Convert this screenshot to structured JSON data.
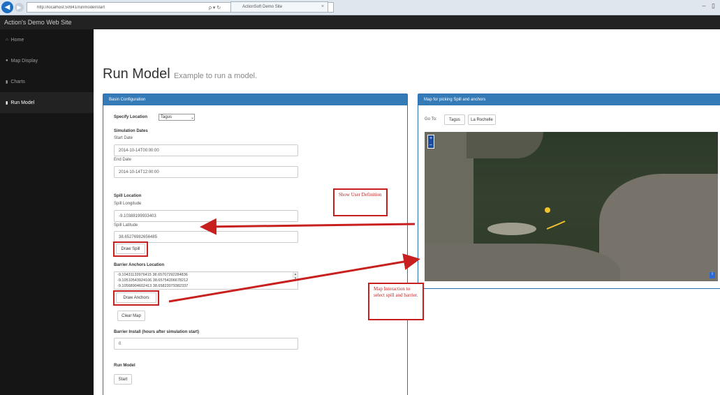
{
  "browser": {
    "url": "http://localhost:50941/runmodel/start",
    "address_controls": "ρ ▾ ↻",
    "tab_title": "ActionSoft Demo Site",
    "window_controls": "– ▯"
  },
  "navbar": {
    "brand": "Action's Demo Web Site"
  },
  "sidebar": {
    "items": [
      {
        "icon": "home-icon",
        "glyph": "⌂",
        "label": "Home"
      },
      {
        "icon": "map-marker-icon",
        "glyph": "●",
        "label": "Map Display"
      },
      {
        "icon": "bar-chart-icon",
        "glyph": "▮",
        "label": "Charts"
      },
      {
        "icon": "bar-chart-icon",
        "glyph": "▮",
        "label": "Run Model"
      }
    ],
    "active_index": 3
  },
  "page": {
    "title": "Run Model",
    "subtitle": "Example to run a model."
  },
  "basin": {
    "title": "Basin Configuration",
    "specify_location_label": "Specify Location",
    "specify_location_value": "Tagus",
    "simulation_dates_label": "Simulation Dates",
    "start_date_label": "Start Date",
    "start_date_value": "2014-10-14T00:00:00",
    "end_date_label": "End Date",
    "end_date_value": "2014-10-14T12:00:00",
    "spill_location_label": "Spill Location",
    "spill_longitude_label": "Spill Longitude",
    "spill_longitude_value": "-9.10388199933403",
    "spill_latitude_label": "Spill Latitude",
    "spill_latitude_value": "38.65276982656485",
    "draw_spill_label": "Draw Spill",
    "barrier_anchors_label": "Barrier Anchors Location",
    "anchors": [
      "-9.10431133976415 38.65707292284836",
      "-9.10510543924106 38.65754206678212",
      "-9.10568904602413 38.65823079382337"
    ],
    "draw_anchors_label": "Draw Anchors",
    "clear_map_label": "Clear Map",
    "barrier_install_label": "Barrier Install (hours after simulation start)",
    "barrier_install_value": "0",
    "run_model_label": "Run Model",
    "start_label": "Start"
  },
  "map_panel": {
    "title": "Map for picking Spill and anchors",
    "goto_label": "Go To:",
    "locations": [
      "Tagus",
      "La Rochelle"
    ],
    "zoom_in": "+",
    "zoom_out": "–",
    "info": "i"
  },
  "annotations": {
    "show_user_definition": "Show User Definition",
    "map_interaction": "Map Interaction to select spill and barrier.",
    "color": "#c8201f"
  },
  "colors": {
    "navbar": "#222222",
    "sidebar": "#151515",
    "panel_header": "#337ab7",
    "spill_marker": "#f2c12e",
    "barrier_line": "#f2c12e"
  }
}
